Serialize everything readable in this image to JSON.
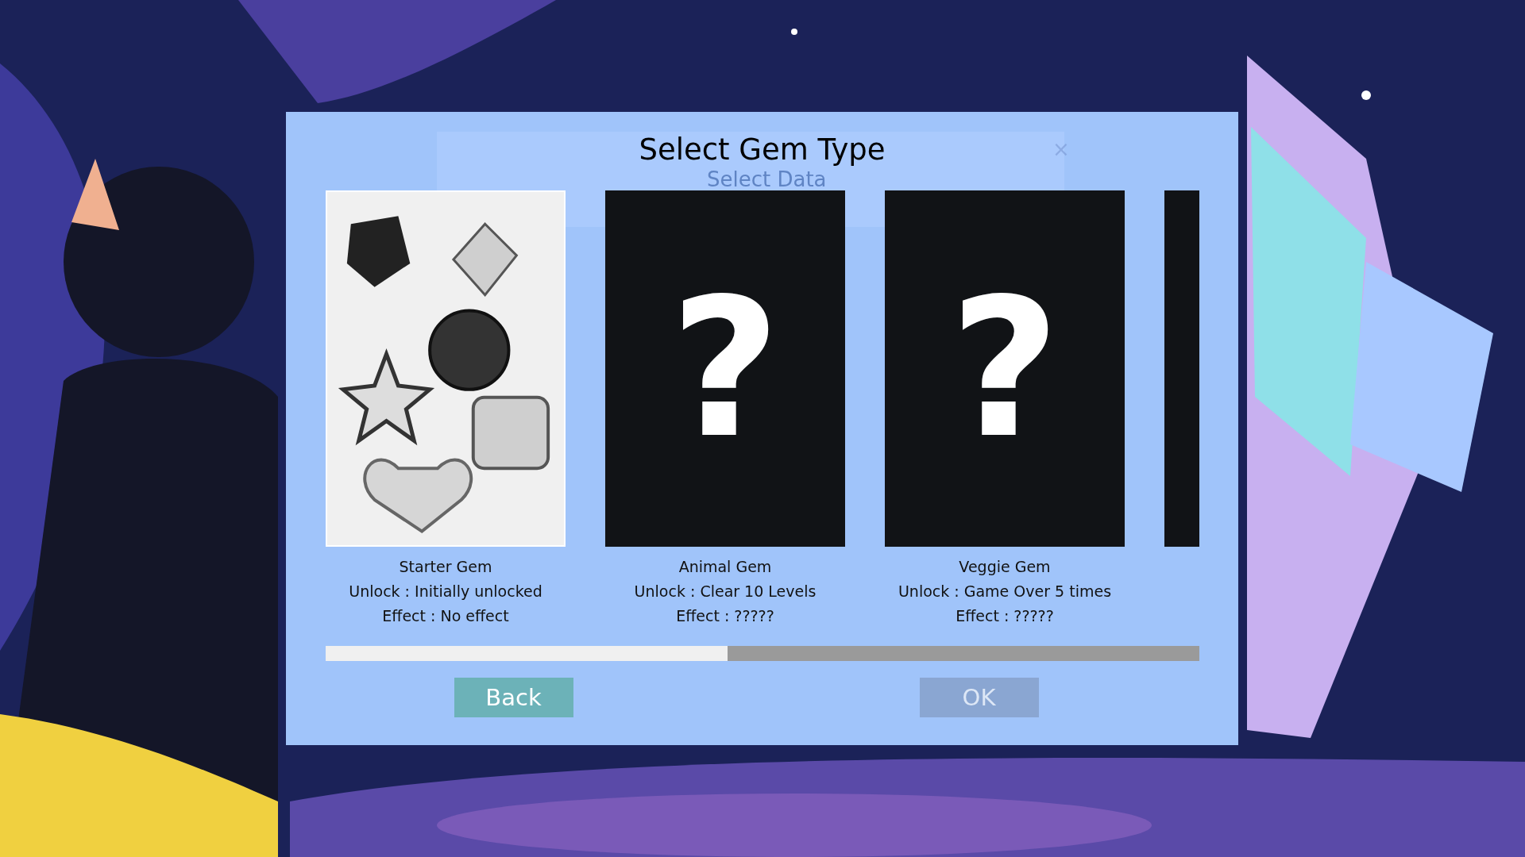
{
  "background_dialog": {
    "title": "Select Data",
    "close": "×"
  },
  "dialog": {
    "title": "Select Gem Type",
    "cards": [
      {
        "kind": "unlocked",
        "selected": true,
        "name": "Starter Gem",
        "unlock": "Unlock : Initially unlocked",
        "effect": "Effect : No effect"
      },
      {
        "kind": "locked",
        "selected": false,
        "mark": "?",
        "name": "Animal Gem",
        "unlock": "Unlock : Clear 10 Levels",
        "effect": "Effect : ?????"
      },
      {
        "kind": "locked",
        "selected": false,
        "mark": "?",
        "name": "Veggie Gem",
        "unlock": "Unlock : Game Over 5 times",
        "effect": "Effect : ?????"
      },
      {
        "kind": "locked",
        "selected": false
      }
    ],
    "scrollbar": {
      "level": 0.46
    },
    "buttons": [
      {
        "label": "Back",
        "disabled": false
      },
      {
        "label": "OK",
        "disabled": true
      }
    ]
  }
}
